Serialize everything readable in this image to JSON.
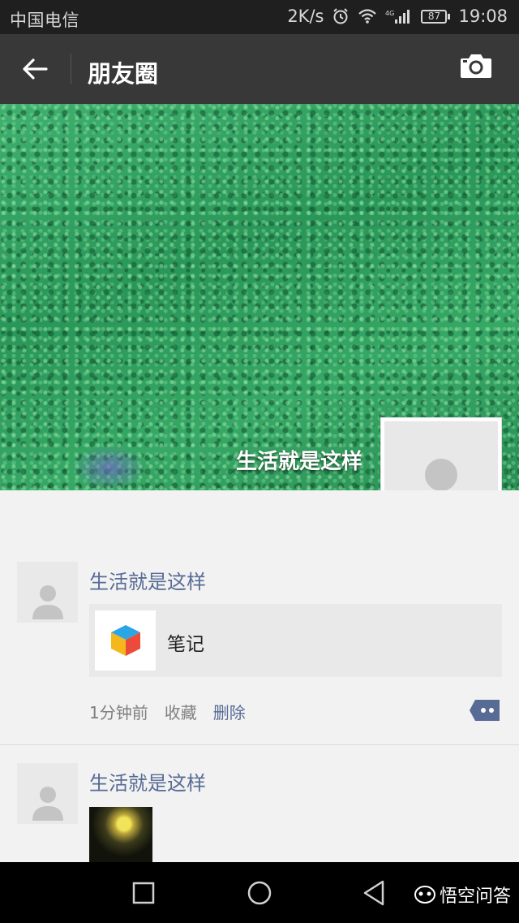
{
  "status_bar": {
    "carrier": "中国电信",
    "network_speed": "2K/s",
    "battery": "87",
    "time": "19:08"
  },
  "nav_bar": {
    "title": "朋友圈"
  },
  "cover": {
    "user_name": "生活就是这样"
  },
  "posts": [
    {
      "author": "生活就是这样",
      "link_title": "笔记",
      "time_ago": "1分钟前",
      "action_favorite": "收藏",
      "action_delete": "删除"
    },
    {
      "author": "生活就是这样"
    }
  ],
  "watermark": {
    "text": "悟空问答"
  },
  "colors": {
    "name_link": "#576b95",
    "nav_bg": "#383838",
    "status_bg": "#1f1f1f"
  }
}
